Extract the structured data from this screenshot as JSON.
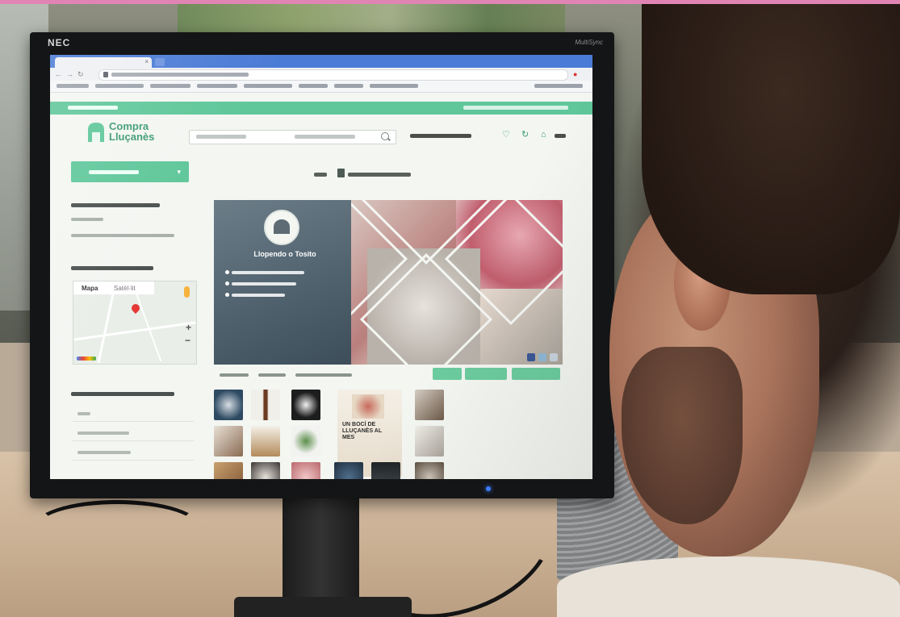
{
  "monitor": {
    "brand": "NEC",
    "model": "MultiSync"
  },
  "browser": {
    "tab_title": "",
    "url": ""
  },
  "site": {
    "brand_line1": "Compra",
    "brand_line2": "Lluçanès",
    "banner_title": "Llopendo o Tosito",
    "promo_text": "UN BOCÍ DE LLUÇANÈS AL MES"
  },
  "map": {
    "tab_map": "Mapa",
    "tab_satellite": "Satèl·lit",
    "zoom_in": "+",
    "zoom_out": "−"
  },
  "colors": {
    "brand_green": "#5fc79a",
    "chrome_blue": "#4a7bd6",
    "map_pin": "#e53935"
  },
  "icons": [
    "search-icon",
    "heart-icon",
    "cart-icon",
    "store-icon",
    "map-pin-icon",
    "pegman-icon",
    "lock-icon"
  ]
}
